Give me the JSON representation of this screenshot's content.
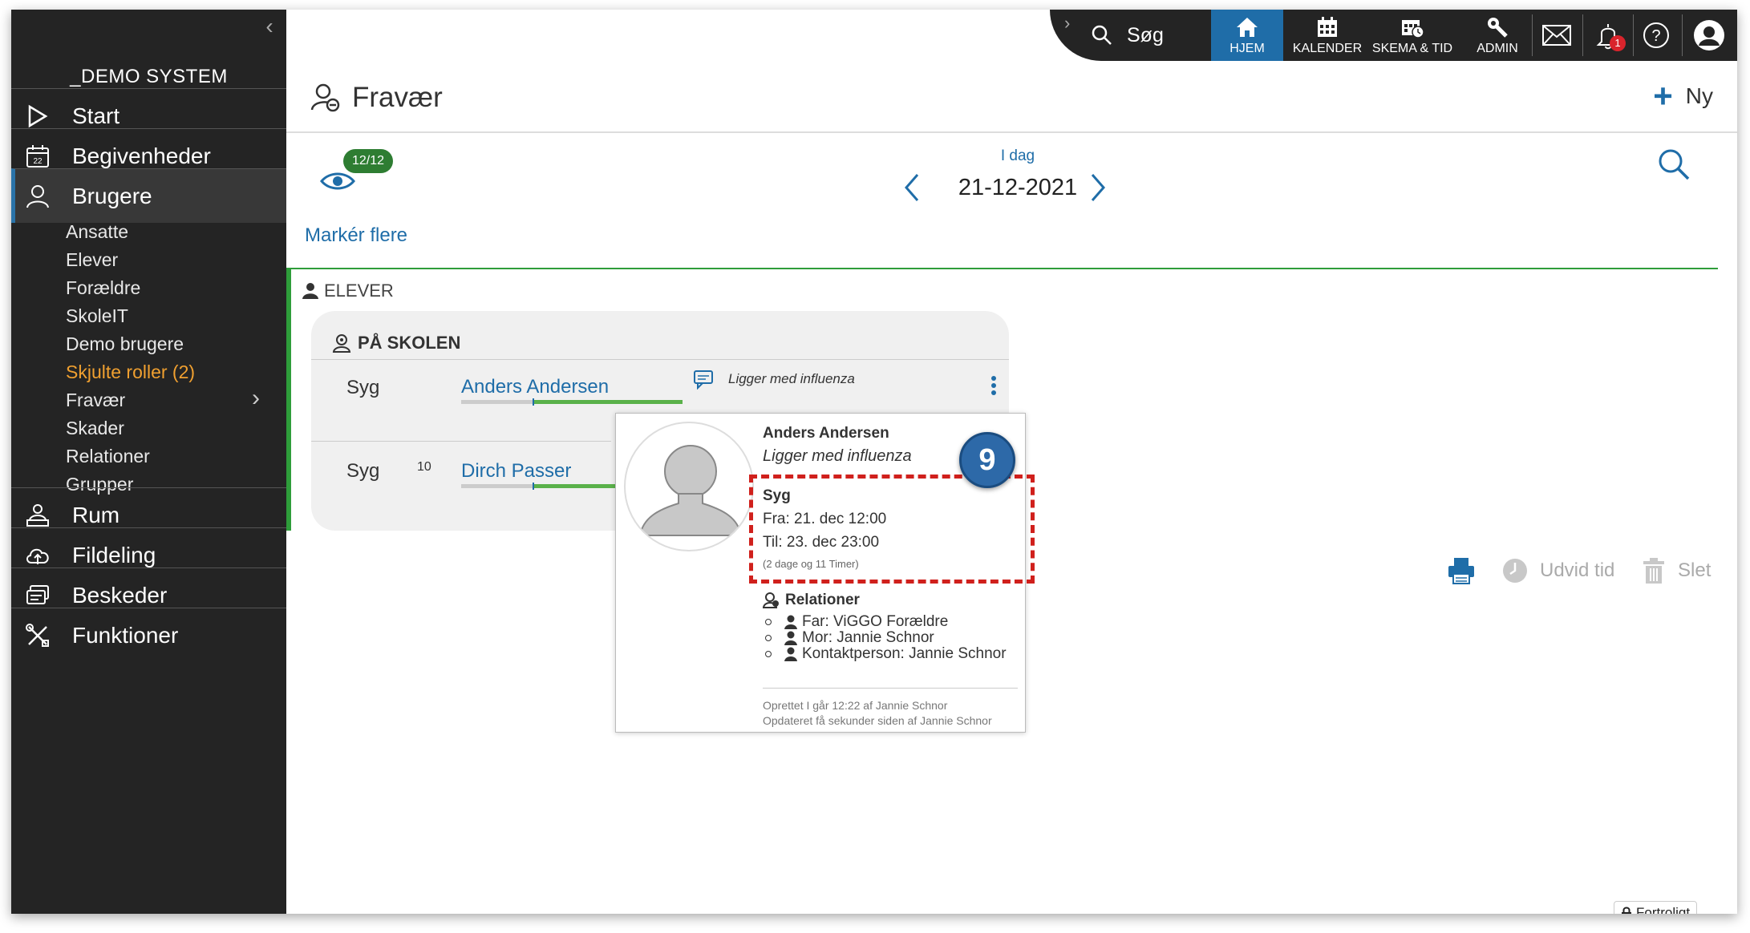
{
  "sidebar": {
    "system_name": "_DEMO SYSTEM",
    "main_items": [
      {
        "label": "Start",
        "icon": "play-icon"
      },
      {
        "label": "Begivenheder",
        "icon": "calendar-icon"
      },
      {
        "label": "Brugere",
        "icon": "users-icon"
      },
      {
        "label": "Rum",
        "icon": "rooms-icon"
      },
      {
        "label": "Fildeling",
        "icon": "cloud-icon"
      },
      {
        "label": "Beskeder",
        "icon": "messages-icon"
      },
      {
        "label": "Funktioner",
        "icon": "tools-icon"
      }
    ],
    "sub_items": [
      "Ansatte",
      "Elever",
      "Forældre",
      "SkoleIT",
      "Demo brugere",
      "Skjulte roller (2)",
      "Fravær",
      "Skader",
      "Relationer",
      "Grupper"
    ]
  },
  "topnav": {
    "search_label": "Søg",
    "buttons": [
      "HJEM",
      "KALENDER",
      "SKEMA & TID",
      "ADMIN"
    ],
    "notification_count": "1"
  },
  "header": {
    "title": "Fravær",
    "new_label": "Ny"
  },
  "toolbar": {
    "eye_badge": "12/12",
    "mark_more": "Markér flere",
    "today_label": "I dag",
    "date": "21-12-2021"
  },
  "section": {
    "label": "ELEVER",
    "card_title": "PÅ SKOLEN",
    "rows": [
      {
        "type": "Syg",
        "num": "",
        "name": "Anders Andersen",
        "note": "Ligger med influenza"
      },
      {
        "type": "Syg",
        "num": "10",
        "name": "Dirch Passer",
        "note": ""
      }
    ]
  },
  "popover": {
    "name": "Anders Andersen",
    "note": "Ligger med influenza",
    "type": "Syg",
    "from": "Fra: 21. dec 12:00",
    "to": "Til: 23. dec 23:00",
    "duration": "(2 dage og 11 Timer)",
    "relations_title": "Relationer",
    "relations": [
      "Far: ViGGO Forældre",
      "Mor: Jannie Schnor",
      "Kontaktperson: Jannie Schnor"
    ],
    "created": "Oprettet I går 12:22 af Jannie Schnor",
    "updated": "Opdateret få sekunder siden af Jannie Schnor"
  },
  "step_number": "9",
  "actions": {
    "extend_label": "Udvid tid",
    "delete_label": "Slet"
  },
  "confidential_label": "Fortroligt",
  "colors": {
    "accent": "#1f6da8",
    "sidebar_bg": "#242424",
    "green": "#2e9d3a",
    "highlight": "#f0a030",
    "dashed": "#d0201c"
  }
}
